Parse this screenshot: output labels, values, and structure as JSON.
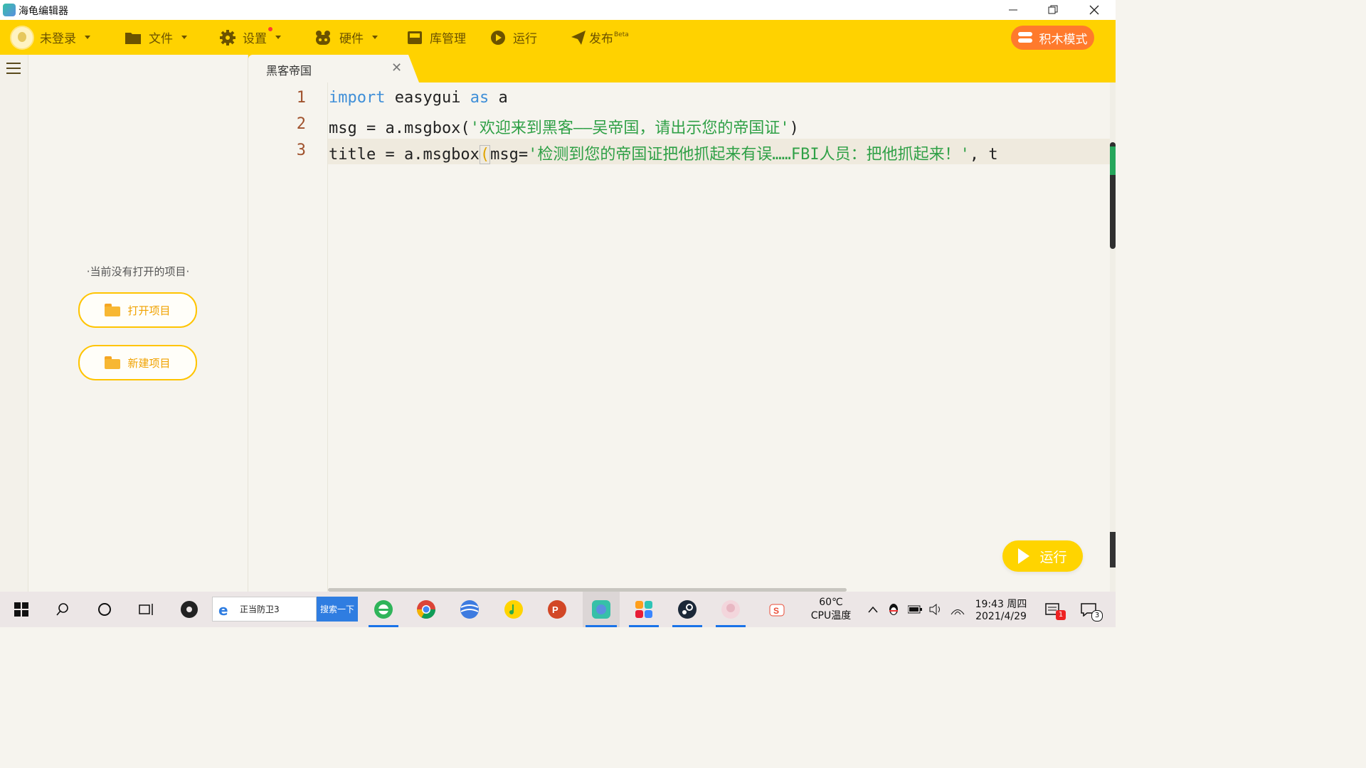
{
  "window": {
    "title": "海龟编辑器",
    "minimize_icon": "minimize-icon",
    "restore_icon": "restore-icon",
    "close_icon": "close-icon"
  },
  "toolbar": {
    "user": "未登录",
    "file": "文件",
    "settings": "设置",
    "hardware": "硬件",
    "library": "库管理",
    "run": "运行",
    "publish": "发布",
    "publish_badge": "Beta",
    "block_mode": "积木模式",
    "accent_color": "#ffd200",
    "text_color": "#6b5200"
  },
  "sidebar": {
    "empty_message": "·当前没有打开的项目·",
    "open_project": "打开项目",
    "new_project": "新建项目"
  },
  "editor": {
    "tab_title": "黑客帝国",
    "lines": [
      {
        "number": "1",
        "tokens": [
          {
            "text": "import",
            "kind": "kw"
          },
          {
            "text": " easygui ",
            "kind": "plain"
          },
          {
            "text": "as",
            "kind": "kw"
          },
          {
            "text": " a",
            "kind": "plain"
          }
        ]
      },
      {
        "number": "2",
        "tokens": [
          {
            "text": "msg = a.msgbox(",
            "kind": "plain"
          },
          {
            "text": "'欢迎来到黑客——吴帝国，请出示您的帝国证'",
            "kind": "str"
          },
          {
            "text": ")",
            "kind": "plain"
          }
        ]
      },
      {
        "number": "3",
        "tokens": [
          {
            "text": "title = a.msgbox",
            "kind": "plain"
          },
          {
            "text": "(",
            "kind": "bracket"
          },
          {
            "text": "msg=",
            "kind": "plain"
          },
          {
            "text": "'检测到您的帝国证把他抓起来有误……FBI人员：把他抓起来！'",
            "kind": "str"
          },
          {
            "text": ", t",
            "kind": "plain"
          }
        ]
      }
    ],
    "run_button": "运行"
  },
  "taskbar": {
    "search_text": "正当防卫3",
    "search_button": "搜索一下",
    "cpu_temp": "60℃",
    "cpu_label": "CPU温度",
    "time": "19:43 周四",
    "date": "2021/4/29",
    "notification_badge": "1",
    "message_badge": "3"
  }
}
